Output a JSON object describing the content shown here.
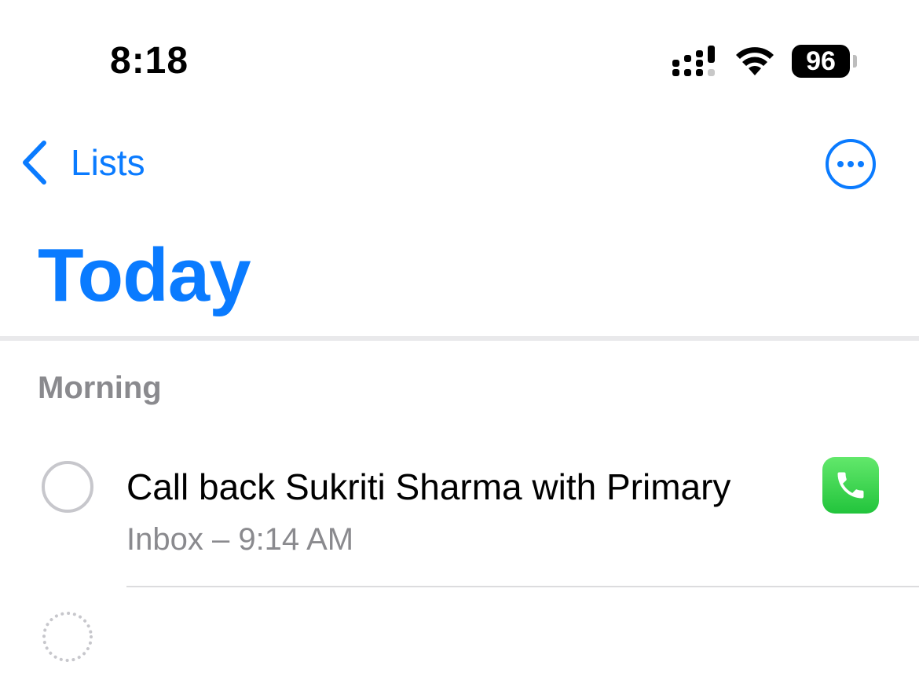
{
  "status_bar": {
    "time": "8:18",
    "battery_level": "96",
    "icons": [
      "cellular-signal-icon",
      "wifi-icon",
      "battery-icon"
    ]
  },
  "nav": {
    "back_label": "Lists",
    "back_icon": "chevron-left-icon",
    "more_icon": "ellipsis-circle-icon"
  },
  "page": {
    "title": "Today"
  },
  "sections": [
    {
      "header": "Morning",
      "reminders": [
        {
          "title": "Call back Sukriti Sharma with Primary",
          "subtitle": "Inbox – 9:14 AM",
          "completed": false,
          "app_icon": "phone-app-icon"
        }
      ]
    }
  ],
  "colors": {
    "accent": "#0a7bff",
    "secondary_text": "#8a8a8e",
    "checkbox_border": "#c7c7cc",
    "phone_green": "#34c759"
  }
}
